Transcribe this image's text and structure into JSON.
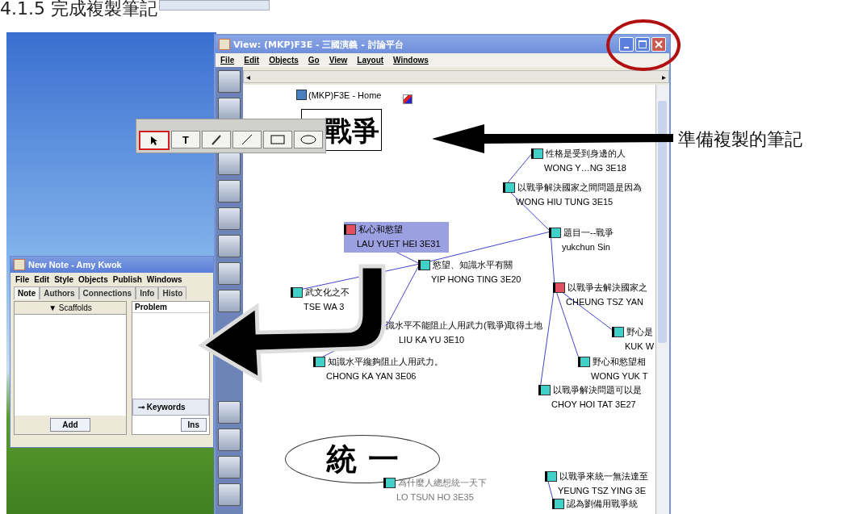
{
  "heading": "4.1.5 完成複製筆記",
  "callout": "準備複製的筆記",
  "view_window": {
    "title": "View: (MKP)F3E - 三國演義 - 討論平台",
    "menu": [
      "File",
      "Edit",
      "Objects",
      "Go",
      "View",
      "Layout",
      "Windows"
    ],
    "home_link": "(MKP)F3E - Home",
    "pictures": [
      {
        "kind": "box",
        "text": "戰爭"
      },
      {
        "kind": "ellipse",
        "text": "統 一"
      }
    ],
    "palette": [
      {
        "kind": "pointer",
        "selected": true
      },
      {
        "kind": "text",
        "label": "T",
        "selected": false
      },
      {
        "kind": "brush",
        "selected": false
      },
      {
        "kind": "line",
        "selected": false
      },
      {
        "kind": "rect",
        "selected": false
      },
      {
        "kind": "ellipse",
        "selected": false
      }
    ],
    "notes": [
      {
        "title": "性格是受到身邊的人",
        "author": "WONG Y…NG 3E18",
        "color": "#40d0c8",
        "selected": false,
        "faded": false
      },
      {
        "title": "以戰爭解決國家之間問題是因為",
        "author": "WONG HIU TUNG 3E15",
        "color": "#40d0c8",
        "selected": false,
        "faded": false
      },
      {
        "title": "私心和慾望",
        "author": "LAU YUET HEI 3E31",
        "color": "#e05060",
        "selected": true,
        "faded": false
      },
      {
        "title": "題目一--戰爭",
        "author": "yukchun Sin",
        "color": "#40d0c8",
        "selected": false,
        "faded": false
      },
      {
        "title": "慾望、知識水平有關",
        "author": "YIP HONG TING 3E20",
        "color": "#40d0c8",
        "selected": false,
        "faded": false
      },
      {
        "title": "武文化之不",
        "author": "TSE WA 3",
        "color": "#40d0c8",
        "selected": false,
        "faded": false
      },
      {
        "title": "識水平不能阻止人用武力(戰爭)取得土地",
        "author": "LIU KA YU 3E10",
        "selected": false,
        "faded": false
      },
      {
        "title": "知識水平纔夠阻止人用武力。",
        "author": "CHONG KA YAN 3E06",
        "color": "#40d0c8",
        "selected": false,
        "faded": false
      },
      {
        "title": "以戰爭去解決國家之",
        "author": "CHEUNG TSZ YAN",
        "color": "#e05060",
        "selected": false,
        "faded": false
      },
      {
        "title": "野心是",
        "author": "KUK W",
        "color": "#40d0c8",
        "selected": false,
        "faded": false
      },
      {
        "title": "野心和慾望相",
        "author": "WONG YUK T",
        "color": "#40d0c8",
        "selected": false,
        "faded": false
      },
      {
        "title": "以戰爭解決問題可以是",
        "author": "CHOY HOI TAT 3E27",
        "color": "#40d0c8",
        "selected": false,
        "faded": false
      },
      {
        "title": "為什麼人總想統一天下",
        "author": "LO TSUN HO 3E35",
        "color": "#40d0c8",
        "selected": false,
        "faded": true
      },
      {
        "title": "以戰爭來統一無法達至",
        "author": "YEUNG TSZ YING 3E",
        "color": "#40d0c8",
        "selected": false,
        "faded": false
      },
      {
        "title": "認為劉備用戰爭統",
        "color": "#40d0c8",
        "selected": false,
        "faded": false
      }
    ],
    "scroll_arrows": [
      "◂",
      "▸"
    ]
  },
  "note_window": {
    "title": "New Note - Amy Kwok",
    "menu": [
      "File",
      "Edit",
      "Style",
      "Objects",
      "Publish",
      "Windows"
    ],
    "tabs": [
      {
        "label": "Note",
        "selected": true
      },
      {
        "label": "Authors",
        "selected": false
      },
      {
        "label": "Connections",
        "selected": false
      },
      {
        "label": "Info",
        "selected": false
      },
      {
        "label": "Histo",
        "selected": false
      }
    ],
    "scaffolds": "▼ Scaffolds",
    "add_button": "Add",
    "problem": "Problem",
    "keywords_icon": "⊸",
    "keywords_button": "Keywords",
    "insert_button": "Ins"
  }
}
